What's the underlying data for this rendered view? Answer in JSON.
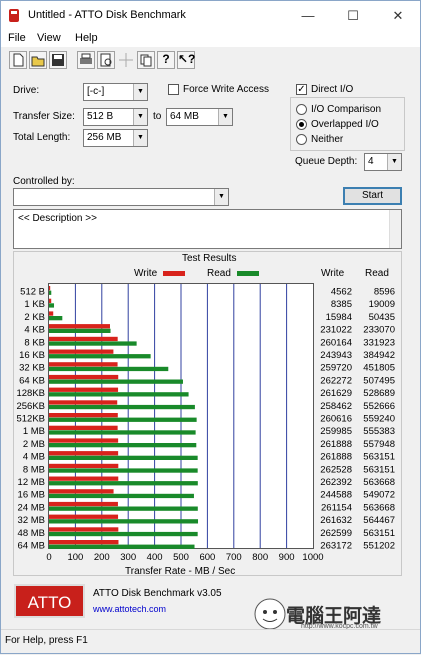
{
  "window": {
    "title": "Untitled - ATTO Disk Benchmark",
    "minimize": "—",
    "maximize": "☐",
    "close": "✕"
  },
  "menu": [
    "File",
    "View",
    "Help"
  ],
  "toolbar_icons": [
    "new-icon",
    "open-icon",
    "save-icon",
    "print-icon",
    "print-preview-icon",
    "move-icon",
    "copy-icon",
    "help-icon",
    "context-help-icon"
  ],
  "form": {
    "drive_label": "Drive:",
    "drive_value": "[-c-]",
    "force_write_label": "Force Write Access",
    "force_write_checked": false,
    "direct_io_label": "Direct I/O",
    "direct_io_checked": true,
    "transfer_size_label": "Transfer Size:",
    "transfer_from": "512 B",
    "to_label": "to",
    "transfer_to": "64 MB",
    "total_length_label": "Total Length:",
    "total_length": "256 MB",
    "io_comparison_label": "I/O Comparison",
    "overlapped_io_label": "Overlapped I/O",
    "neither_label": "Neither",
    "selected_io": "Overlapped I/O",
    "queue_depth_label": "Queue Depth:",
    "queue_depth": "4",
    "controlled_by_label": "Controlled by:",
    "controlled_by_value": "",
    "start_label": "Start",
    "description": "<< Description >>"
  },
  "results_title": "Test Results",
  "legend": {
    "write": "Write",
    "read": "Read",
    "write_color": "#d8231c",
    "read_color": "#198a2a"
  },
  "columns": {
    "write": "Write",
    "read": "Read"
  },
  "chart_data": {
    "type": "bar",
    "orientation": "horizontal",
    "title": "Test Results",
    "xlabel": "Transfer Rate - MB / Sec",
    "xlim": [
      0,
      1000
    ],
    "xticks": [
      "0",
      "100",
      "200",
      "300",
      "400",
      "500",
      "600",
      "700",
      "800",
      "900",
      "1000"
    ],
    "categories": [
      "512 B",
      "1 KB",
      "2 KB",
      "4 KB",
      "8 KB",
      "16 KB",
      "32 KB",
      "64 KB",
      "128KB",
      "256KB",
      "512KB",
      "1 MB",
      "2 MB",
      "4 MB",
      "8 MB",
      "12 MB",
      "16 MB",
      "24 MB",
      "32 MB",
      "48 MB",
      "64 MB"
    ],
    "series": [
      {
        "name": "Write",
        "values": [
          4562,
          8385,
          15984,
          231022,
          260164,
          243943,
          259720,
          262272,
          261629,
          258462,
          260616,
          259985,
          261888,
          261888,
          262528,
          262392,
          244588,
          261154,
          261632,
          262599,
          263172
        ]
      },
      {
        "name": "Read",
        "values": [
          8596,
          19009,
          50435,
          233070,
          331923,
          384942,
          451805,
          507495,
          528689,
          552666,
          559240,
          555383,
          557948,
          563151,
          563151,
          563668,
          549072,
          563668,
          564467,
          563151,
          551202
        ]
      }
    ]
  },
  "footer": {
    "logo": "ATTO",
    "version": "ATTO Disk Benchmark v3.05",
    "url": "www.attotech.com",
    "watermark": "電腦王阿達",
    "watermark_url": "http://www.kocpc.com.tw"
  },
  "status": "For Help, press F1"
}
